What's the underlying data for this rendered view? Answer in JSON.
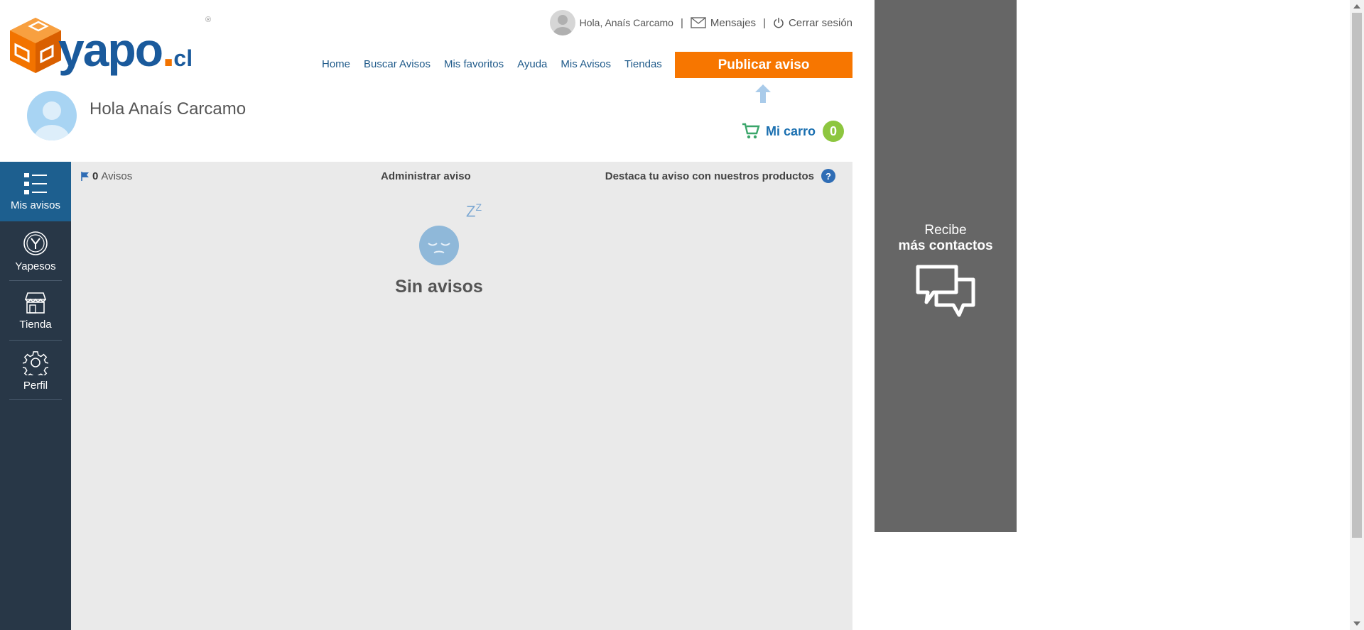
{
  "brand": {
    "logo_text": "yapo",
    "logo_dot": ".",
    "logo_cl": "cl",
    "registered": "®"
  },
  "topbar": {
    "greeting": "Hola, Anaís Carcamo",
    "separator": "|",
    "messages": "Mensajes",
    "logout": "Cerrar sesión"
  },
  "nav": {
    "items": [
      {
        "label": "Home"
      },
      {
        "label": "Buscar Avisos"
      },
      {
        "label": "Mis favoritos"
      },
      {
        "label": "Ayuda"
      },
      {
        "label": "Mis Avisos"
      },
      {
        "label": "Tiendas"
      }
    ]
  },
  "publish_button": "Publicar aviso",
  "profile": {
    "greeting": "Hola Anaís Carcamo"
  },
  "cart": {
    "label": "Mi carro",
    "count": "0"
  },
  "sidebar": {
    "items": [
      {
        "label": "Mis avisos",
        "icon": "list-icon",
        "active": true
      },
      {
        "label": "Yapesos",
        "icon": "yapesos-coin-icon"
      },
      {
        "label": "Tienda",
        "icon": "store-icon"
      },
      {
        "label": "Perfil",
        "icon": "gear-icon"
      }
    ]
  },
  "content": {
    "count_value": "0",
    "count_label": "Avisos",
    "admin_label": "Administrar aviso",
    "destaca_label": "Destaca tu aviso con nuestros productos",
    "help": "?",
    "zz": "Z",
    "zz_small": "Z",
    "empty_title": "Sin avisos"
  },
  "ad": {
    "line1": "Recibe",
    "line2": "más contactos"
  },
  "colors": {
    "accent_orange": "#f77600",
    "brand_blue": "#1a5a9c",
    "sidebar_bg": "#283747",
    "sidebar_active": "#1d5f8f",
    "content_bg": "#eaeaea",
    "cart_badge": "#8dc63f",
    "ad_bg": "#666666"
  }
}
